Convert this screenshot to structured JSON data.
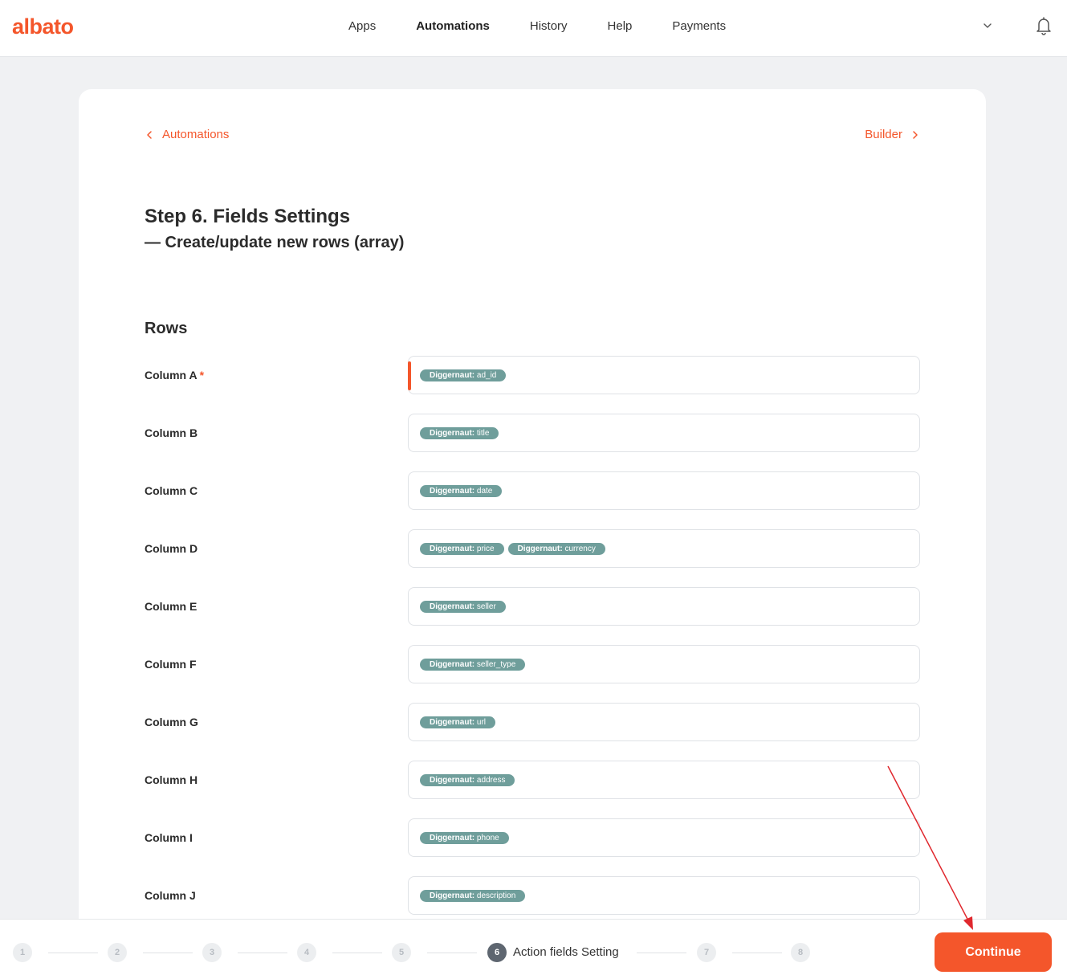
{
  "brand": {
    "logo": "albato",
    "accent": "#f4562b",
    "tag_color": "#6f9e9b"
  },
  "nav": {
    "items": [
      "Apps",
      "Automations",
      "History",
      "Help",
      "Payments"
    ],
    "active": "Automations"
  },
  "breadcrumb": {
    "back": "Automations",
    "next": "Builder"
  },
  "page": {
    "title": "Step 6. Fields Settings",
    "subtitle": "— Create/update new rows (array)",
    "section": "Rows"
  },
  "rows": [
    {
      "label": "Column A",
      "required": true,
      "tags": [
        {
          "source": "Diggernaut:",
          "field": "ad_id"
        }
      ]
    },
    {
      "label": "Column B",
      "required": false,
      "tags": [
        {
          "source": "Diggernaut:",
          "field": "title"
        }
      ]
    },
    {
      "label": "Column C",
      "required": false,
      "tags": [
        {
          "source": "Diggernaut:",
          "field": "date"
        }
      ]
    },
    {
      "label": "Column D",
      "required": false,
      "tags": [
        {
          "source": "Diggernaut:",
          "field": "price"
        },
        {
          "source": "Diggernaut:",
          "field": "currency"
        }
      ]
    },
    {
      "label": "Column E",
      "required": false,
      "tags": [
        {
          "source": "Diggernaut:",
          "field": "seller"
        }
      ]
    },
    {
      "label": "Column F",
      "required": false,
      "tags": [
        {
          "source": "Diggernaut:",
          "field": "seller_type"
        }
      ]
    },
    {
      "label": "Column G",
      "required": false,
      "tags": [
        {
          "source": "Diggernaut:",
          "field": "url"
        }
      ]
    },
    {
      "label": "Column H",
      "required": false,
      "tags": [
        {
          "source": "Diggernaut:",
          "field": "address"
        }
      ]
    },
    {
      "label": "Column I",
      "required": false,
      "tags": [
        {
          "source": "Diggernaut:",
          "field": "phone"
        }
      ]
    },
    {
      "label": "Column J",
      "required": false,
      "tags": [
        {
          "source": "Diggernaut:",
          "field": "description"
        }
      ]
    }
  ],
  "required_mark": "*",
  "stepper": {
    "steps": [
      "1",
      "2",
      "3",
      "4",
      "5",
      "6",
      "7",
      "8"
    ],
    "active": "6",
    "active_label": "Action fields Setting"
  },
  "continue_label": "Continue",
  "icons": {
    "back": "chevron-left-icon",
    "next": "chevron-right-icon",
    "menu": "chevron-down-icon",
    "notifications": "bell-icon"
  }
}
